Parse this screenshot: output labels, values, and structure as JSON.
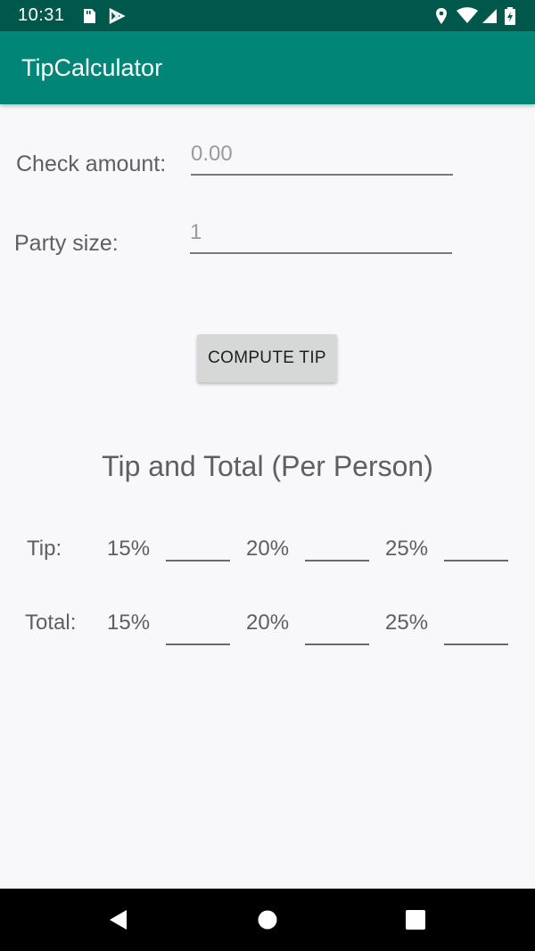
{
  "status_bar": {
    "time": "10:31",
    "left_icons": [
      "sd-card-icon",
      "play-store-icon"
    ],
    "right_icons": [
      "location-icon",
      "wifi-icon",
      "signal-icon",
      "battery-icon"
    ]
  },
  "app_bar": {
    "title": "TipCalculator",
    "color": "#008577"
  },
  "form": {
    "check_amount_label": "Check amount:",
    "check_amount_placeholder": "0.00",
    "party_size_label": "Party size:",
    "party_size_placeholder": "1"
  },
  "compute_button": {
    "label": "COMPUTE TIP"
  },
  "results": {
    "title": "Tip and Total (Per Person)",
    "tip_label": "Tip:",
    "total_label": "Total:",
    "percentages": [
      "15%",
      "20%",
      "25%"
    ]
  },
  "nav_bar": {
    "buttons": [
      "back-icon",
      "home-icon",
      "recents-icon"
    ]
  }
}
